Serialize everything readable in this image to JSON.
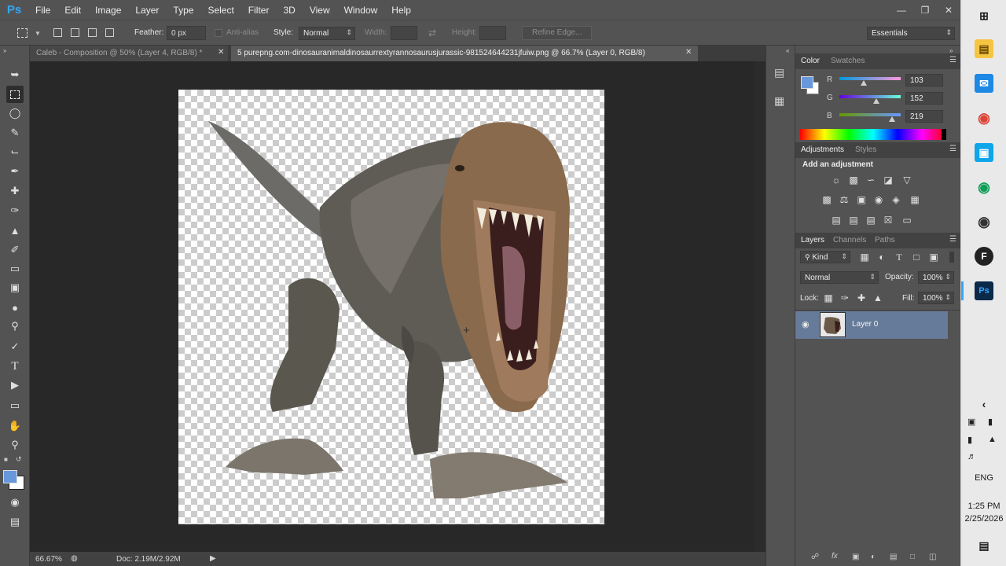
{
  "app": {
    "logo": "Ps"
  },
  "menu": [
    "File",
    "Edit",
    "Image",
    "Layer",
    "Type",
    "Select",
    "Filter",
    "3D",
    "View",
    "Window",
    "Help"
  ],
  "window_controls": {
    "minimize": "minimize-icon",
    "restore": "restore-icon",
    "close": "close-icon"
  },
  "options": {
    "feather_label": "Feather:",
    "feather_value": "0 px",
    "antialias_label": "Anti-alias",
    "style_label": "Style:",
    "style_value": "Normal",
    "width_label": "Width:",
    "height_label": "Height:",
    "refine_edge": "Refine Edge...",
    "workspace": "Essentials"
  },
  "tabs": [
    {
      "label": "Caleb - Composition @ 50% (Layer 4, RGB/8) *",
      "active": false
    },
    {
      "label": "5 purepng.com-dinosauranimaldinosaurrextyrannosaurusjurassic-981524644231jfuiw.png @ 66.7% (Layer 0, RGB/8)",
      "active": true
    }
  ],
  "status": {
    "zoom": "66.67%",
    "doc": "Doc: 2.19M/2.92M"
  },
  "color_panel": {
    "tabs": [
      "Color",
      "Swatches"
    ],
    "r_label": "R",
    "g_label": "G",
    "b_label": "B",
    "r": "103",
    "g": "152",
    "b": "219",
    "r_fraction": 0.4,
    "g_fraction": 0.6,
    "b_fraction": 0.86,
    "foreground": "#6798db",
    "background": "#ffffff"
  },
  "adjustments_panel": {
    "tabs": [
      "Adjustments",
      "Styles"
    ],
    "heading": "Add an adjustment"
  },
  "layers_panel": {
    "tabs": [
      "Layers",
      "Channels",
      "Paths"
    ],
    "kind": "Kind",
    "blend_mode": "Normal",
    "opacity_label": "Opacity:",
    "opacity_value": "100%",
    "lock_label": "Lock:",
    "fill_label": "Fill:",
    "fill_value": "100%",
    "layers": [
      {
        "name": "Layer 0",
        "visible": true
      }
    ]
  },
  "taskbar": {
    "language": "ENG",
    "time": "1:25 PM",
    "date": "2/25/2026"
  }
}
